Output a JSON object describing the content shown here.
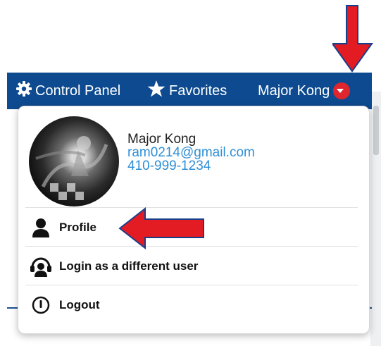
{
  "navbar": {
    "control_panel": "Control Panel",
    "favorites": "Favorites",
    "user_name": "Major Kong"
  },
  "dropdown": {
    "user": {
      "name": "Major Kong",
      "email": "ram0214@gmail.com",
      "phone": "410-999-1234"
    },
    "items": [
      {
        "label": "Profile",
        "icon": "person-icon"
      },
      {
        "label": "Login as a different user",
        "icon": "switch-user-icon"
      },
      {
        "label": "Logout",
        "icon": "power-icon"
      }
    ]
  },
  "colors": {
    "navbar": "#0d4a8f",
    "accent_red": "#e0262d",
    "link_blue": "#2f8fd6"
  }
}
